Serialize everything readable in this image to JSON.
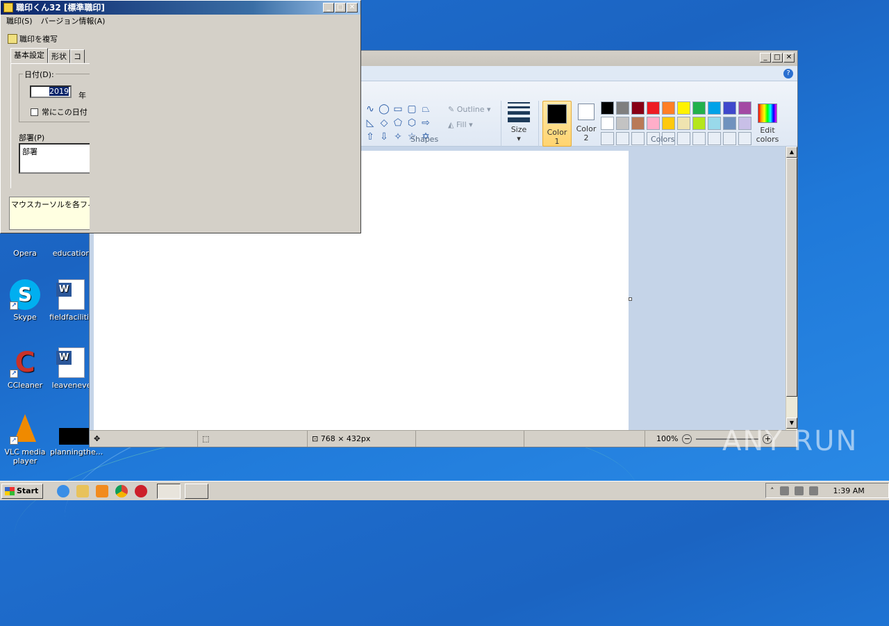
{
  "stamp_app": {
    "title": "職印くん32 [標準職印]",
    "menu": [
      "職印(S)",
      "バージョン情報(A)"
    ],
    "copy_label": "職印を複写",
    "tabs": [
      "基本設定",
      "形状",
      "コ"
    ],
    "date_label": "日付(D):",
    "year_value": "2019",
    "year_suffix": "年",
    "always_checkbox": "常にこの日付",
    "dept_label": "部署(P)",
    "dept_value": "部署",
    "hint_text": "マウスカーソルを各フィ"
  },
  "paint": {
    "shapes_label": "Shapes",
    "outline_label": "Outline",
    "fill_label": "Fill",
    "size_label": "Size",
    "color1_label": "Color 1",
    "color2_label": "Color 2",
    "colors_label": "Colors",
    "edit_colors_label": "Edit colors",
    "color1": "#000000",
    "color2": "#ffffff",
    "palette": [
      "#000000",
      "#7f7f7f",
      "#880015",
      "#ed1c24",
      "#ff7f27",
      "#fff200",
      "#22b14c",
      "#00a2e8",
      "#3f48cc",
      "#a349a4",
      "#ffffff",
      "#c3c3c3",
      "#b97a57",
      "#ffaec9",
      "#ffc90e",
      "#efe4b0",
      "#b5e61d",
      "#99d9ea",
      "#7092be",
      "#c8bfe7",
      "#e8eef6",
      "#e8eef6",
      "#e8eef6",
      "#e8eef6",
      "#e8eef6",
      "#e8eef6",
      "#e8eef6",
      "#e8eef6",
      "#e8eef6",
      "#e8eef6"
    ],
    "status_size": "768 × 432px",
    "zoom": "100%"
  },
  "desktop_icons": [
    {
      "label": "Opera",
      "color": "#cc1f2a"
    },
    {
      "label": "education",
      "color": "#ffffff"
    },
    {
      "label": "Skype",
      "color": "#00aff0"
    },
    {
      "label": "fieldfacilitie",
      "color": "#2b579a"
    },
    {
      "label": "CCleaner",
      "color": "#c8322a"
    },
    {
      "label": "leaveneve",
      "color": "#2b579a"
    },
    {
      "label": "VLC media player",
      "color": "#f08a00"
    },
    {
      "label": "planningthe...",
      "color": "#000000"
    }
  ],
  "taskbar": {
    "start_label": "Start",
    "clock": "1:39 AM"
  },
  "watermark": "ANY RUN"
}
